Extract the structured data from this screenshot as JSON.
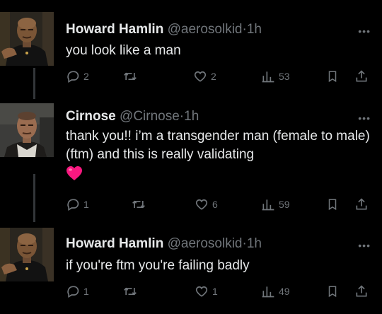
{
  "tweets": [
    {
      "name": "Howard Hamlin",
      "handle": "@aerosolkid",
      "dot": "·",
      "time": "1h",
      "text": "you look like a man",
      "replies": "2",
      "likes": "2",
      "views": "53"
    },
    {
      "name": "Cirnose",
      "handle": "@Cirnose",
      "dot": "·",
      "time": "1h",
      "text": "thank you!! i’m a transgender man (female to male) (ftm) and this is really validating",
      "emoji": "red-heart-emoji",
      "replies": "1",
      "likes": "6",
      "views": "59"
    },
    {
      "name": "Howard Hamlin",
      "handle": "@aerosolkid",
      "dot": "·",
      "time": "1h",
      "text": "if you're ftm you're failing badly",
      "replies": "1",
      "likes": "1",
      "views": "49"
    }
  ],
  "more_label": "•••",
  "icons": {
    "reply": "reply-icon",
    "retweet": "retweet-icon",
    "like": "like-icon",
    "views": "views-icon",
    "bookmark": "bookmark-icon",
    "share": "share-icon"
  },
  "colors": {
    "background": "#000000",
    "text": "#e7e9ea",
    "secondary": "#71767b",
    "heart": "#f91880"
  }
}
